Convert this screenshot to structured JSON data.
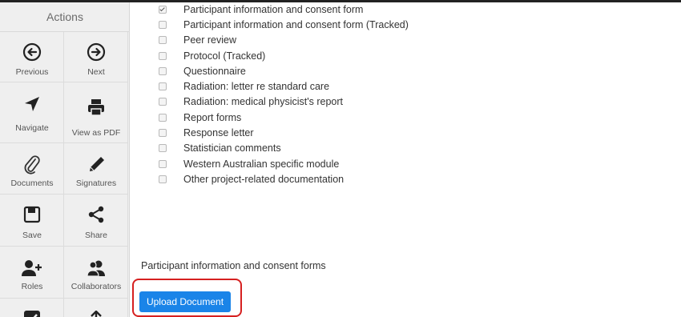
{
  "sidebar": {
    "title": "Actions",
    "actions": [
      {
        "label": "Previous",
        "icon": "arrow-left-circle-icon"
      },
      {
        "label": "Next",
        "icon": "arrow-right-circle-icon"
      },
      {
        "label": "Navigate",
        "icon": "navigate-arrow-icon"
      },
      {
        "label": "View as PDF",
        "icon": "printer-icon"
      },
      {
        "label": "Documents",
        "icon": "paperclip-icon"
      },
      {
        "label": "Signatures",
        "icon": "pencil-icon"
      },
      {
        "label": "Save",
        "icon": "floppy-disk-icon"
      },
      {
        "label": "Share",
        "icon": "share-icon"
      },
      {
        "label": "Roles",
        "icon": "user-plus-icon"
      },
      {
        "label": "Collaborators",
        "icon": "users-icon"
      },
      {
        "label": "",
        "icon": "checkbox-icon"
      },
      {
        "label": "",
        "icon": "upload-arrow-icon"
      }
    ]
  },
  "documents": {
    "items": [
      {
        "label": "Participant information and consent form",
        "checked": true
      },
      {
        "label": "Participant information and consent form (Tracked)",
        "checked": false
      },
      {
        "label": "Peer review",
        "checked": false
      },
      {
        "label": "Protocol (Tracked)",
        "checked": false
      },
      {
        "label": "Questionnaire",
        "checked": false
      },
      {
        "label": "Radiation: letter re standard care",
        "checked": false
      },
      {
        "label": "Radiation: medical physicist's report",
        "checked": false
      },
      {
        "label": "Report forms",
        "checked": false
      },
      {
        "label": "Response letter",
        "checked": false
      },
      {
        "label": "Statistician comments",
        "checked": false
      },
      {
        "label": "Western Australian specific module",
        "checked": false
      },
      {
        "label": "Other project-related documentation",
        "checked": false
      }
    ]
  },
  "upload_section": {
    "label": "Participant information and consent forms",
    "button_label": "Upload Document"
  },
  "colors": {
    "button_blue": "#1a84e8",
    "highlight_red": "#d62020",
    "sidebar_bg": "#efefef"
  }
}
